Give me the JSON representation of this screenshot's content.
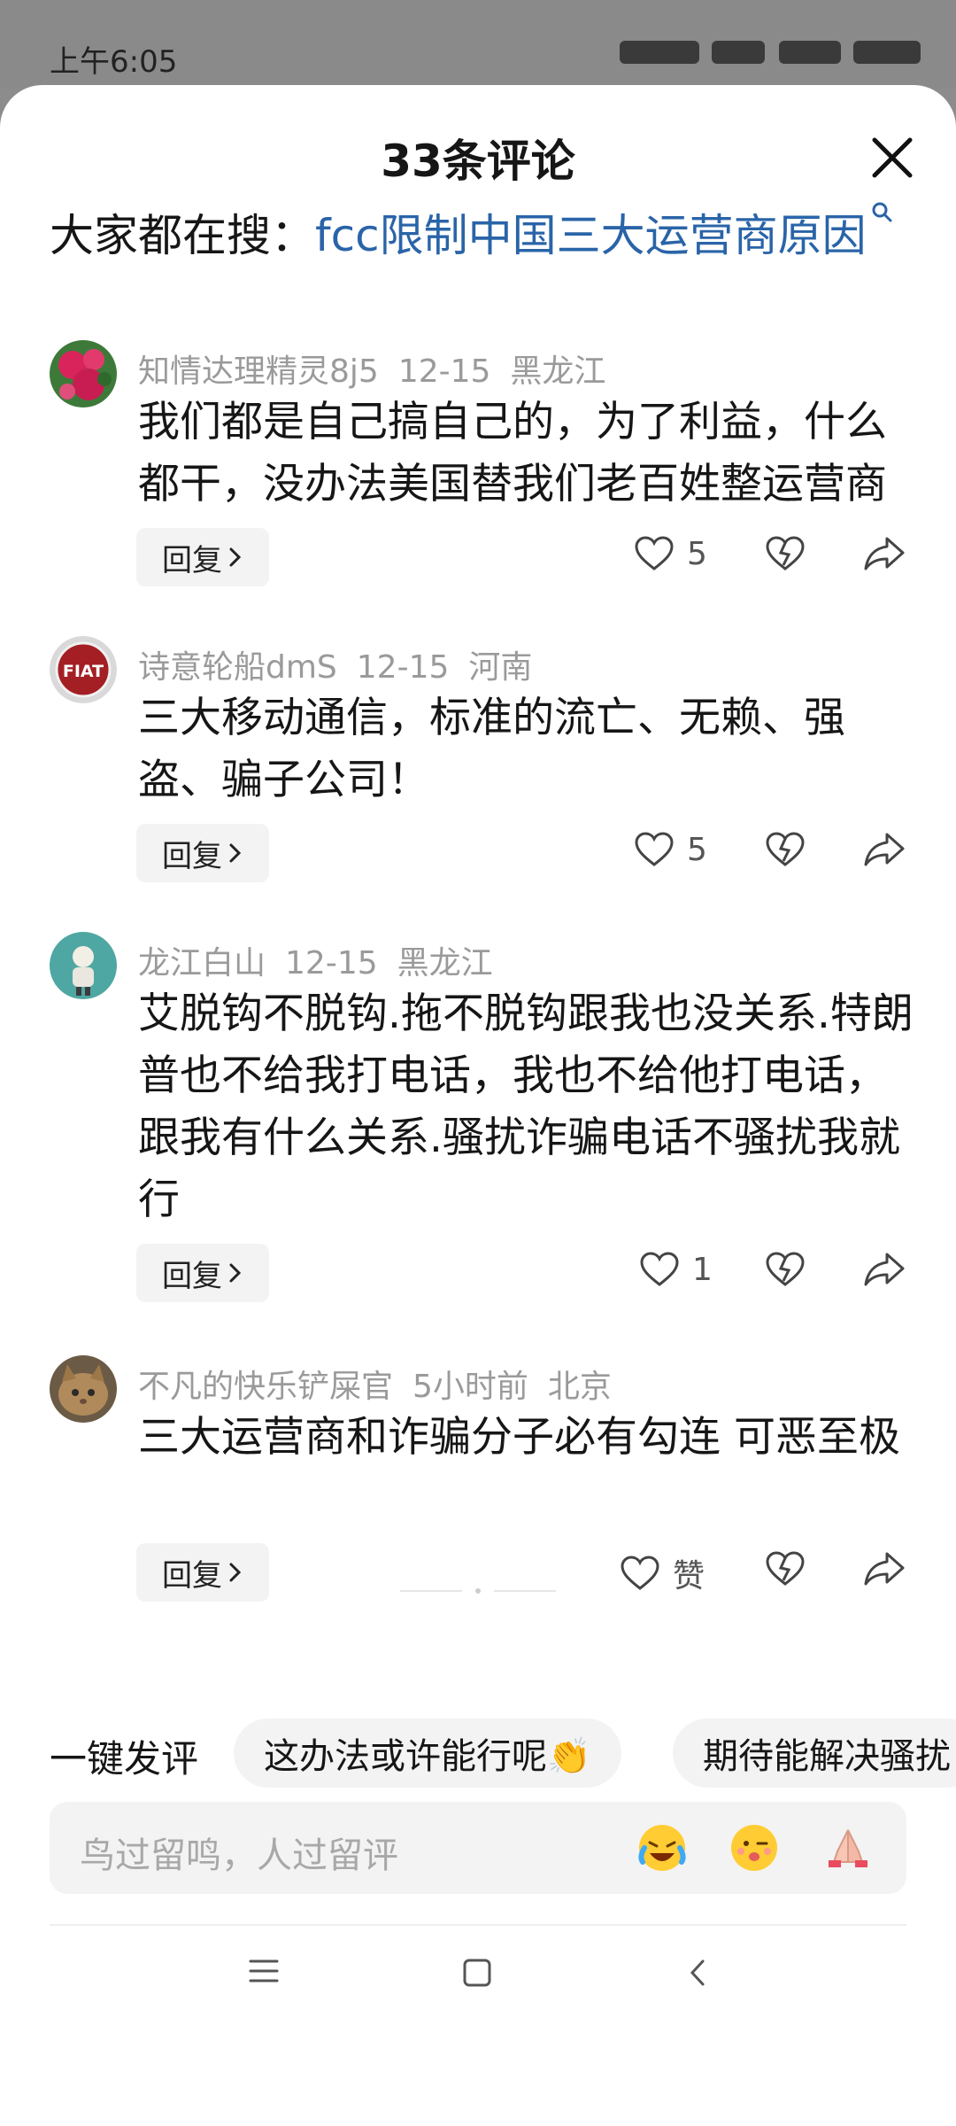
{
  "status": {
    "time": "上午6:05"
  },
  "header": {
    "title": "33条评论"
  },
  "search": {
    "prefix": "大家都在搜：",
    "query": "fcc限制中国三大运营商原因"
  },
  "comments": [
    {
      "user": "知情达理精灵8j5",
      "date": "12-15",
      "location": "黑龙江",
      "text": "我们都是自己搞自己的，为了利益，什么都干，没办法美国替我们老百姓整运营商",
      "likes": "5",
      "avatar": "flower-avatar"
    },
    {
      "user": "诗意轮船dmS",
      "date": "12-15",
      "location": "河南",
      "text": "三大移动通信，标准的流亡、无赖、强盗、骗子公司！",
      "likes": "5",
      "avatar": "fiat-logo-avatar",
      "avatar_text": "FIAT"
    },
    {
      "user": "龙江白山",
      "date": "12-15",
      "location": "黑龙江",
      "text": "艾脱钩不脱钩.拖不脱钩跟我也没关系.特朗普也不给我打电话，我也不给他打电话，跟我有什么关系.骚扰诈骗电话不骚扰我就行",
      "likes": "1",
      "avatar": "cartoon-person-avatar"
    },
    {
      "user": "不凡的快乐铲屎官",
      "date": "5小时前",
      "location": "北京",
      "text": "三大运营商和诈骗分子必有勾连 可恶至极",
      "likes": "赞",
      "avatar": "cat-avatar"
    }
  ],
  "reply_label": "回复",
  "quick": {
    "label": "一键发评",
    "chips": [
      "这办法或许能行呢👏",
      "期待能解决骚扰"
    ]
  },
  "input": {
    "placeholder": "鸟过留鸣，人过留评"
  },
  "emojis": [
    "laughing-crying-emoji",
    "winking-emoji",
    "praying-hands-emoji"
  ],
  "colors": {
    "link": "#2a64a8",
    "meta": "#9a9a9a",
    "chip_bg": "#f3f3f3"
  }
}
